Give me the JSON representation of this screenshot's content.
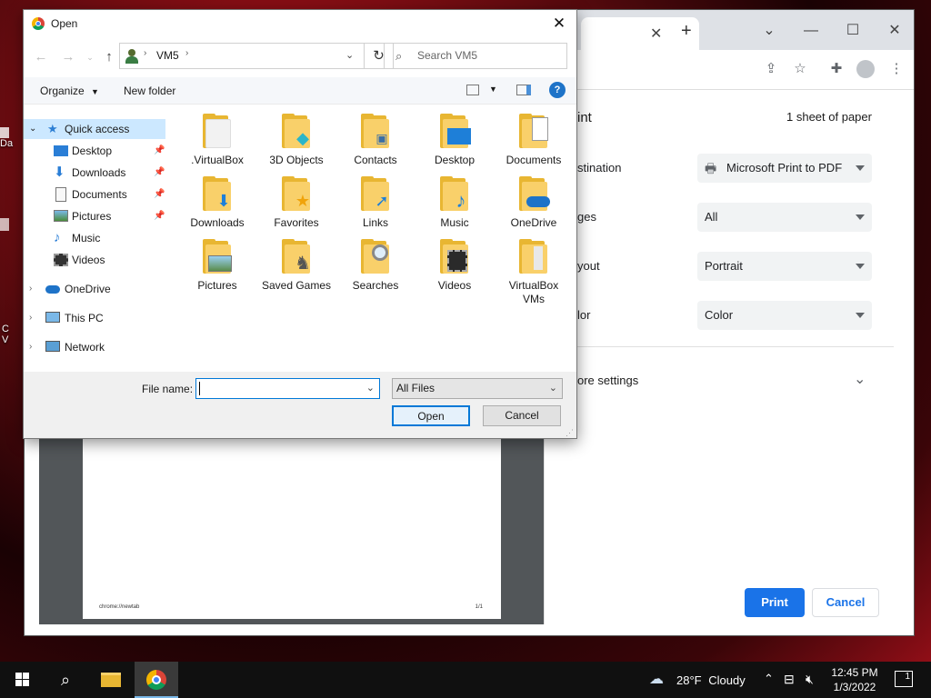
{
  "desktop": {
    "fragments": [
      "Da",
      "C",
      "V"
    ]
  },
  "chrome": {
    "print_panel": {
      "heading": "int",
      "sheets": "1 sheet of paper",
      "destination_label": "stination",
      "destination_value": "Microsoft Print to PDF",
      "pages_label": "ges",
      "pages_value": "All",
      "layout_label": "yout",
      "layout_value": "Portrait",
      "color_label": "lor",
      "color_value": "Color",
      "more_settings": "ore settings",
      "print_button": "Print",
      "cancel_button": "Cancel"
    },
    "preview": {
      "footer_left": "chrome://newtab",
      "footer_right": "1/1"
    }
  },
  "dialog": {
    "title": "Open",
    "address": {
      "segment": "VM5"
    },
    "search_placeholder": "Search VM5",
    "commands": {
      "organize": "Organize",
      "new_folder": "New folder"
    },
    "nav": {
      "quick_access": "Quick access",
      "items": [
        "Desktop",
        "Downloads",
        "Documents",
        "Pictures",
        "Music",
        "Videos"
      ],
      "onedrive": "OneDrive",
      "this_pc": "This PC",
      "network": "Network"
    },
    "folders": [
      {
        "label": ".VirtualBox"
      },
      {
        "label": "3D Objects"
      },
      {
        "label": "Contacts"
      },
      {
        "label": "Desktop"
      },
      {
        "label": "Documents"
      },
      {
        "label": "Downloads"
      },
      {
        "label": "Favorites"
      },
      {
        "label": "Links"
      },
      {
        "label": "Music"
      },
      {
        "label": "OneDrive"
      },
      {
        "label": "Pictures"
      },
      {
        "label": "Saved Games"
      },
      {
        "label": "Searches"
      },
      {
        "label": "Videos"
      },
      {
        "label": "VirtualBox VMs"
      }
    ],
    "file_name_label": "File name:",
    "file_name_value": "",
    "file_type": "All Files",
    "open_button": "Open",
    "cancel_button": "Cancel"
  },
  "taskbar": {
    "weather_temp": "28°F",
    "weather_desc": "Cloudy",
    "time": "12:45 PM",
    "date": "1/3/2022",
    "notification_count": "1"
  }
}
